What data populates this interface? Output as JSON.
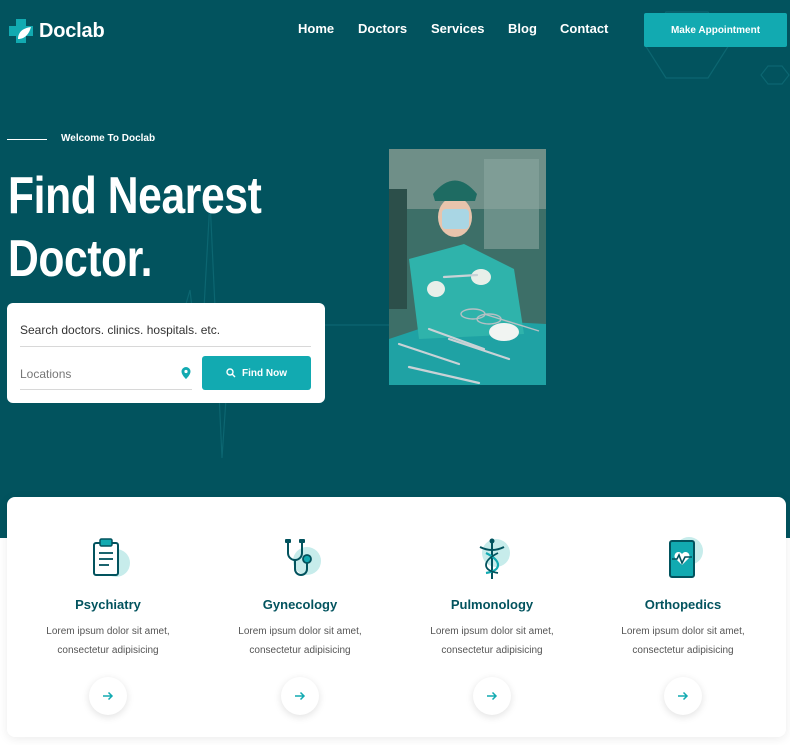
{
  "brand": {
    "name": "Doclab",
    "accent": "#12aab1",
    "primary": "#02535e"
  },
  "nav": {
    "items": [
      "Home",
      "Doctors",
      "Services",
      "Blog",
      "Contact"
    ]
  },
  "cta_label": "Make Appointment",
  "hero": {
    "welcome": "Welcome To Doclab",
    "headline_line1": "Find Nearest",
    "headline_line2": "Doctor."
  },
  "search": {
    "query_placeholder": "Search doctors. clinics. hospitals. etc.",
    "location_placeholder": "Locations",
    "button_label": "Find Now",
    "icons": [
      "map-pin-icon",
      "search-icon"
    ]
  },
  "services": [
    {
      "title": "Psychiatry",
      "desc_line1": "Lorem ipsum dolor sit amet,",
      "desc_line2": "consectetur adipisicing",
      "icon": "clipboard-icon"
    },
    {
      "title": "Gynecology",
      "desc_line1": "Lorem ipsum dolor sit amet,",
      "desc_line2": "consectetur adipisicing",
      "icon": "stethoscope-icon"
    },
    {
      "title": "Pulmonology",
      "desc_line1": "Lorem ipsum dolor sit amet,",
      "desc_line2": "consectetur adipisicing",
      "icon": "caduceus-icon"
    },
    {
      "title": "Orthopedics",
      "desc_line1": "Lorem ipsum dolor sit amet,",
      "desc_line2": "consectetur adipisicing",
      "icon": "tablet-heartbeat-icon"
    }
  ]
}
